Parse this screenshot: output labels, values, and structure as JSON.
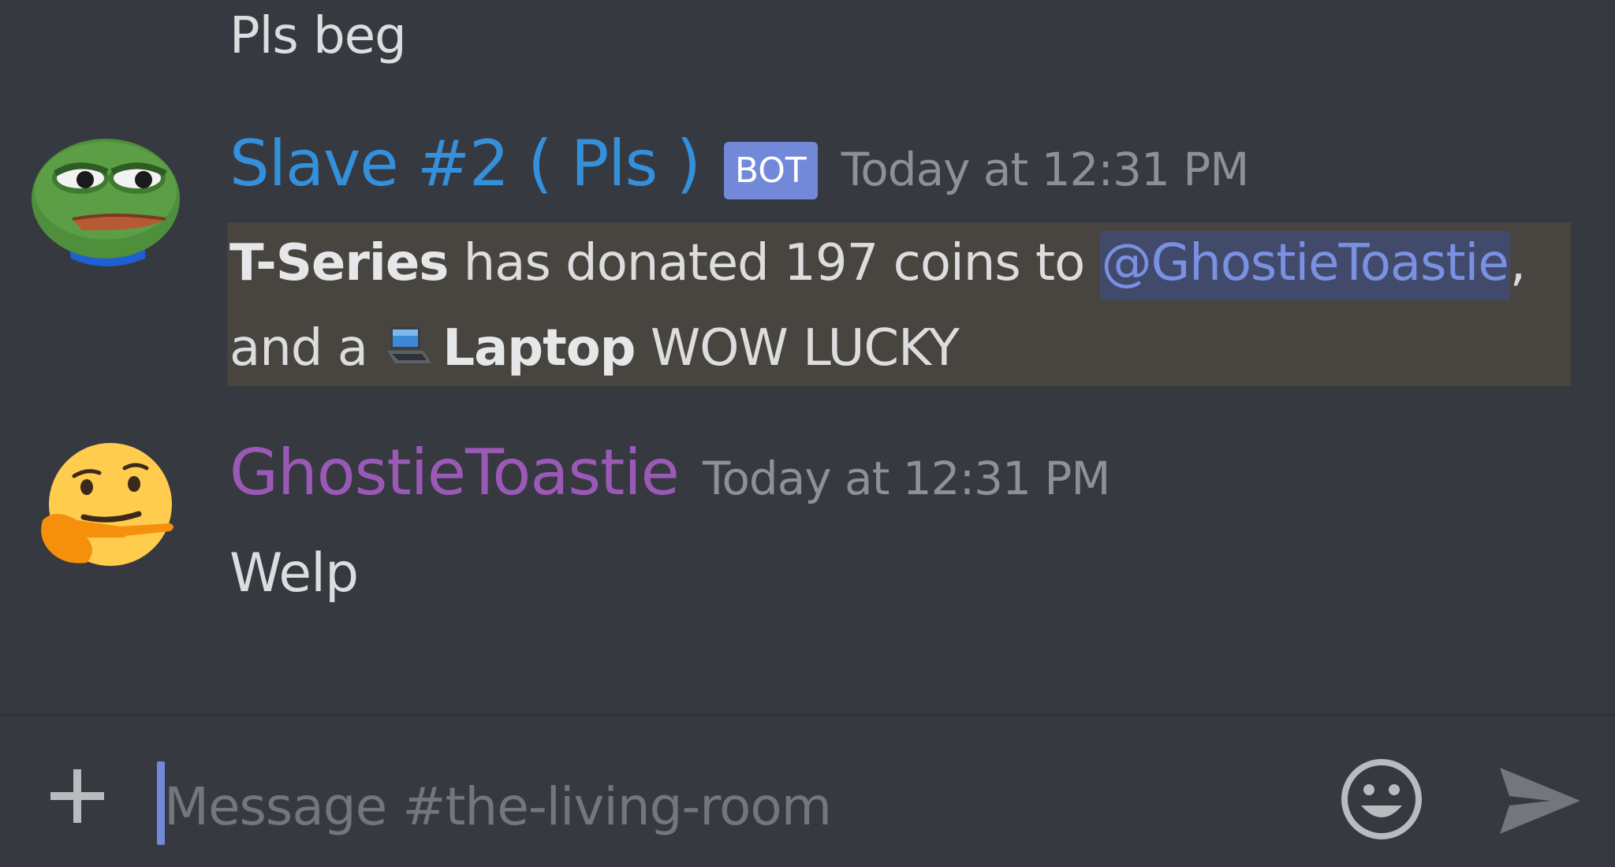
{
  "channel": {
    "input_placeholder": "Message #the-living-room"
  },
  "messages": [
    {
      "type": "continuation",
      "text": "Pls beg"
    },
    {
      "author": "Slave #2 ( Pls )",
      "author_color": "#3490db",
      "bot_tag": "BOT",
      "timestamp": "Today at 12:31 PM",
      "avatar_icon": "pepe-frog-avatar",
      "highlighted": true,
      "content": {
        "donor": "T-Series",
        "phrase": " has donated 197 coins to ",
        "mention": "@GhostieToastie",
        "comma": ",",
        "and_a": "and a ",
        "item_icon": "laptop-icon",
        "item": "Laptop",
        "suffix": " WOW LUCKY"
      }
    },
    {
      "author": "GhostieToastie",
      "author_color": "#9b59b6",
      "timestamp": "Today at 12:31 PM",
      "avatar_icon": "thinking-face-avatar",
      "text": "Welp"
    }
  ],
  "colors": {
    "background": "#363940",
    "mention_bg": "#424a6b",
    "mention_text": "#7a91e2",
    "highlight_bg": "#48443f",
    "bot_tag_bg": "#7289da"
  }
}
